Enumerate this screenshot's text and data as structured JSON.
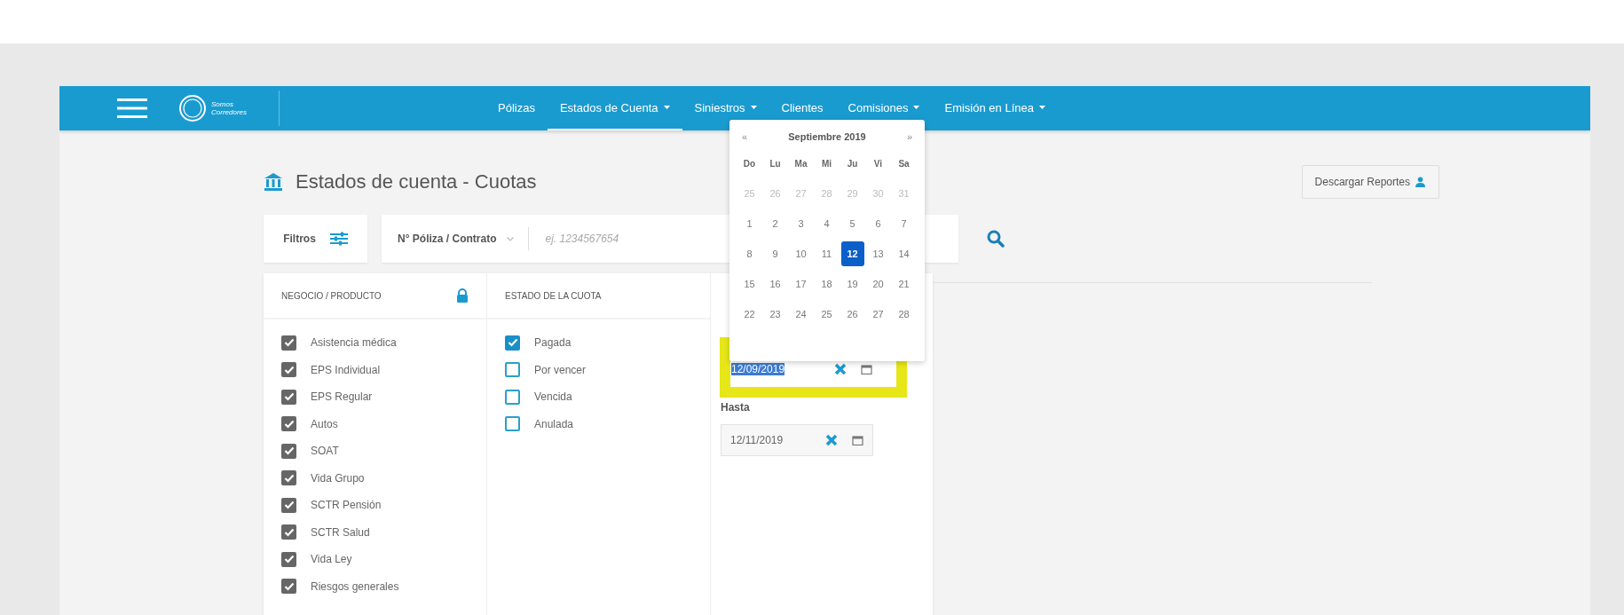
{
  "navbar": {
    "logo_lines": [
      "Somos",
      "Corredores"
    ],
    "items": [
      {
        "label": "Pólizas",
        "dropdown": false,
        "selected": false
      },
      {
        "label": "Estados de Cuenta",
        "dropdown": true,
        "selected": true
      },
      {
        "label": "Siniestros",
        "dropdown": true,
        "selected": false
      },
      {
        "label": "Clientes",
        "dropdown": false,
        "selected": false
      },
      {
        "label": "Comisiones",
        "dropdown": true,
        "selected": false
      },
      {
        "label": "Emisión en Línea",
        "dropdown": true,
        "selected": false
      }
    ]
  },
  "page_title": "Estados de cuenta - Cuotas",
  "download_button": "Descargar Reportes",
  "filters_button": "Filtros",
  "search": {
    "field_select": "N° Póliza / Contrato",
    "placeholder": "ej. 1234567654"
  },
  "filter_columns": [
    {
      "title": "NEGOCIO / PRODUCTO",
      "locked": true,
      "options": [
        {
          "label": "Asistencia médica",
          "checked": true
        },
        {
          "label": "EPS Individual",
          "checked": true
        },
        {
          "label": "EPS Regular",
          "checked": true
        },
        {
          "label": "Autos",
          "checked": true
        },
        {
          "label": "SOAT",
          "checked": true
        },
        {
          "label": "Vida Grupo",
          "checked": true
        },
        {
          "label": "SCTR Pensión",
          "checked": true
        },
        {
          "label": "SCTR Salud",
          "checked": true
        },
        {
          "label": "Vida Ley",
          "checked": true
        },
        {
          "label": "Riesgos generales",
          "checked": true
        }
      ]
    },
    {
      "title": "ESTADO DE LA CUOTA",
      "locked": false,
      "options": [
        {
          "label": "Pagada",
          "checked": true
        },
        {
          "label": "Por vencer",
          "checked": false
        },
        {
          "label": "Vencida",
          "checked": false
        },
        {
          "label": "Anulada",
          "checked": false
        }
      ]
    }
  ],
  "calendar": {
    "prev": "«",
    "month": "Septiembre 2019",
    "next": "»",
    "weekdays": [
      "Do",
      "Lu",
      "Ma",
      "Mi",
      "Ju",
      "Vi",
      "Sa"
    ],
    "weeks": [
      [
        {
          "day": "25",
          "other_month": true,
          "selected": false
        },
        {
          "day": "26",
          "other_month": true,
          "selected": false
        },
        {
          "day": "27",
          "other_month": true,
          "selected": false
        },
        {
          "day": "28",
          "other_month": true,
          "selected": false
        },
        {
          "day": "29",
          "other_month": true,
          "selected": false
        },
        {
          "day": "30",
          "other_month": true,
          "selected": false
        },
        {
          "day": "31",
          "other_month": true,
          "selected": false
        }
      ],
      [
        {
          "day": "1",
          "other_month": false,
          "selected": false
        },
        {
          "day": "2",
          "other_month": false,
          "selected": false
        },
        {
          "day": "3",
          "other_month": false,
          "selected": false
        },
        {
          "day": "4",
          "other_month": false,
          "selected": false
        },
        {
          "day": "5",
          "other_month": false,
          "selected": false
        },
        {
          "day": "6",
          "other_month": false,
          "selected": false
        },
        {
          "day": "7",
          "other_month": false,
          "selected": false
        }
      ],
      [
        {
          "day": "8",
          "other_month": false,
          "selected": false
        },
        {
          "day": "9",
          "other_month": false,
          "selected": false
        },
        {
          "day": "10",
          "other_month": false,
          "selected": false
        },
        {
          "day": "11",
          "other_month": false,
          "selected": false
        },
        {
          "day": "12",
          "other_month": false,
          "selected": true
        },
        {
          "day": "13",
          "other_month": false,
          "selected": false
        },
        {
          "day": "14",
          "other_month": false,
          "selected": false
        }
      ],
      [
        {
          "day": "15",
          "other_month": false,
          "selected": false
        },
        {
          "day": "16",
          "other_month": false,
          "selected": false
        },
        {
          "day": "17",
          "other_month": false,
          "selected": false
        },
        {
          "day": "18",
          "other_month": false,
          "selected": false
        },
        {
          "day": "19",
          "other_month": false,
          "selected": false
        },
        {
          "day": "20",
          "other_month": false,
          "selected": false
        },
        {
          "day": "21",
          "other_month": false,
          "selected": false
        }
      ],
      [
        {
          "day": "22",
          "other_month": false,
          "selected": false
        },
        {
          "day": "23",
          "other_month": false,
          "selected": false
        },
        {
          "day": "24",
          "other_month": false,
          "selected": false
        },
        {
          "day": "25",
          "other_month": false,
          "selected": false
        },
        {
          "day": "26",
          "other_month": false,
          "selected": false
        },
        {
          "day": "27",
          "other_month": false,
          "selected": false
        },
        {
          "day": "28",
          "other_month": false,
          "selected": false
        }
      ]
    ]
  },
  "date_from": {
    "value": "12/09/2019",
    "highlighted": true
  },
  "date_to": {
    "label": "Hasta",
    "value": "12/11/2019",
    "highlighted": false
  }
}
